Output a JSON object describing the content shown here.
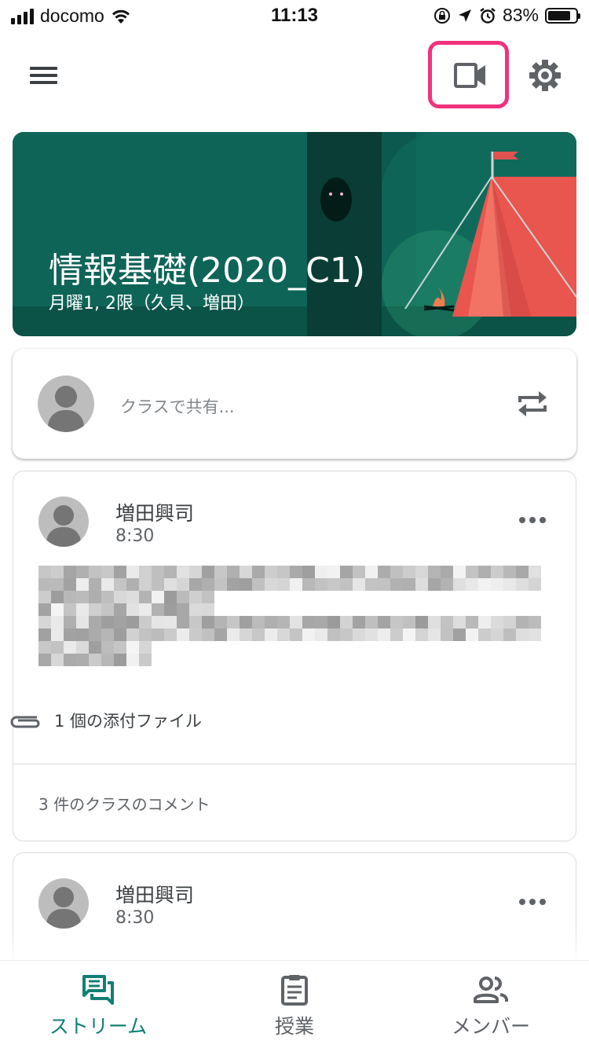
{
  "status_bar": {
    "carrier": "docomo",
    "time": "11:13",
    "battery": "83%",
    "battery_level": 0.83
  },
  "toolbar": {
    "menu_icon": "hamburger-menu-icon",
    "video_icon": "video-camera-icon",
    "settings_icon": "gear-icon",
    "highlight_color": "#f0327c"
  },
  "class_banner": {
    "title": "情報基礎(2020_C1)",
    "subtitle": "月曜1, 2限（久貝、増田）",
    "background_color": "#0f6458"
  },
  "share_box": {
    "placeholder": "クラスで共有...",
    "repost_icon": "repost-icon"
  },
  "posts": [
    {
      "author": "増田興司",
      "time": "8:30",
      "attachment_label": "1 個の添付ファイル",
      "comments_label": "3 件のクラスのコメント"
    },
    {
      "author": "増田興司",
      "time": "8:30"
    }
  ],
  "bottom_nav": {
    "accent_color": "#137f74",
    "items": [
      {
        "label": "ストリーム",
        "icon": "stream-icon",
        "active": true
      },
      {
        "label": "授業",
        "icon": "classwork-icon",
        "active": false
      },
      {
        "label": "メンバー",
        "icon": "people-icon",
        "active": false
      }
    ]
  }
}
